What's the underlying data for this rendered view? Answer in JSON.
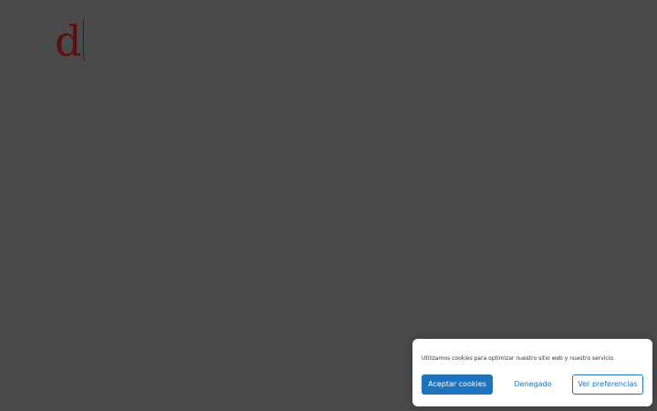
{
  "logo": {
    "letter": "d"
  },
  "cookie_banner": {
    "message": "Utilizamos cookies para optimizar nuestro sitio web y nuestro servicio.",
    "accept_label": "Aceptar cookies",
    "deny_label": "Denegado",
    "preferences_label": "Ver preferencias"
  },
  "colors": {
    "background": "#4a4a4a",
    "logo": "#5a1010",
    "accent": "#1e73be"
  }
}
